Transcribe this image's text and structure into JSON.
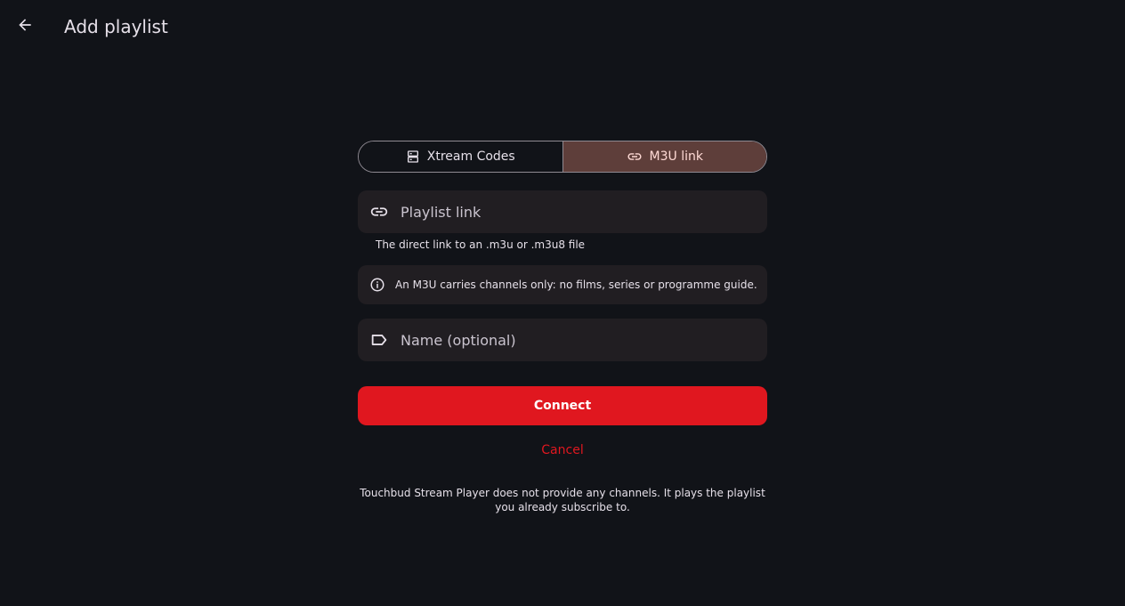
{
  "header": {
    "title": "Add playlist",
    "back_icon": "arrow-back-icon"
  },
  "tabs": [
    {
      "label": "Xtream Codes",
      "icon": "server-icon",
      "selected": false
    },
    {
      "label": "M3U link",
      "icon": "link-icon",
      "selected": true
    }
  ],
  "playlist_link": {
    "placeholder": "Playlist link",
    "value": "",
    "icon": "link-icon",
    "helper": "The direct link to an .m3u or .m3u8 file"
  },
  "info": {
    "icon": "info-icon",
    "text": "An M3U carries channels only: no films, series or programme guide."
  },
  "name_field": {
    "placeholder": "Name (optional)",
    "value": "",
    "icon": "label-icon"
  },
  "actions": {
    "connect_label": "Connect",
    "cancel_label": "Cancel"
  },
  "footer": {
    "note": "Touchbud Stream Player does not provide any channels. It plays the playlist you already subscribe to."
  },
  "colors": {
    "background": "#111318",
    "accent": "#e0171f",
    "selected_segment": "#5e3e3a",
    "field_background": "#211e22"
  }
}
